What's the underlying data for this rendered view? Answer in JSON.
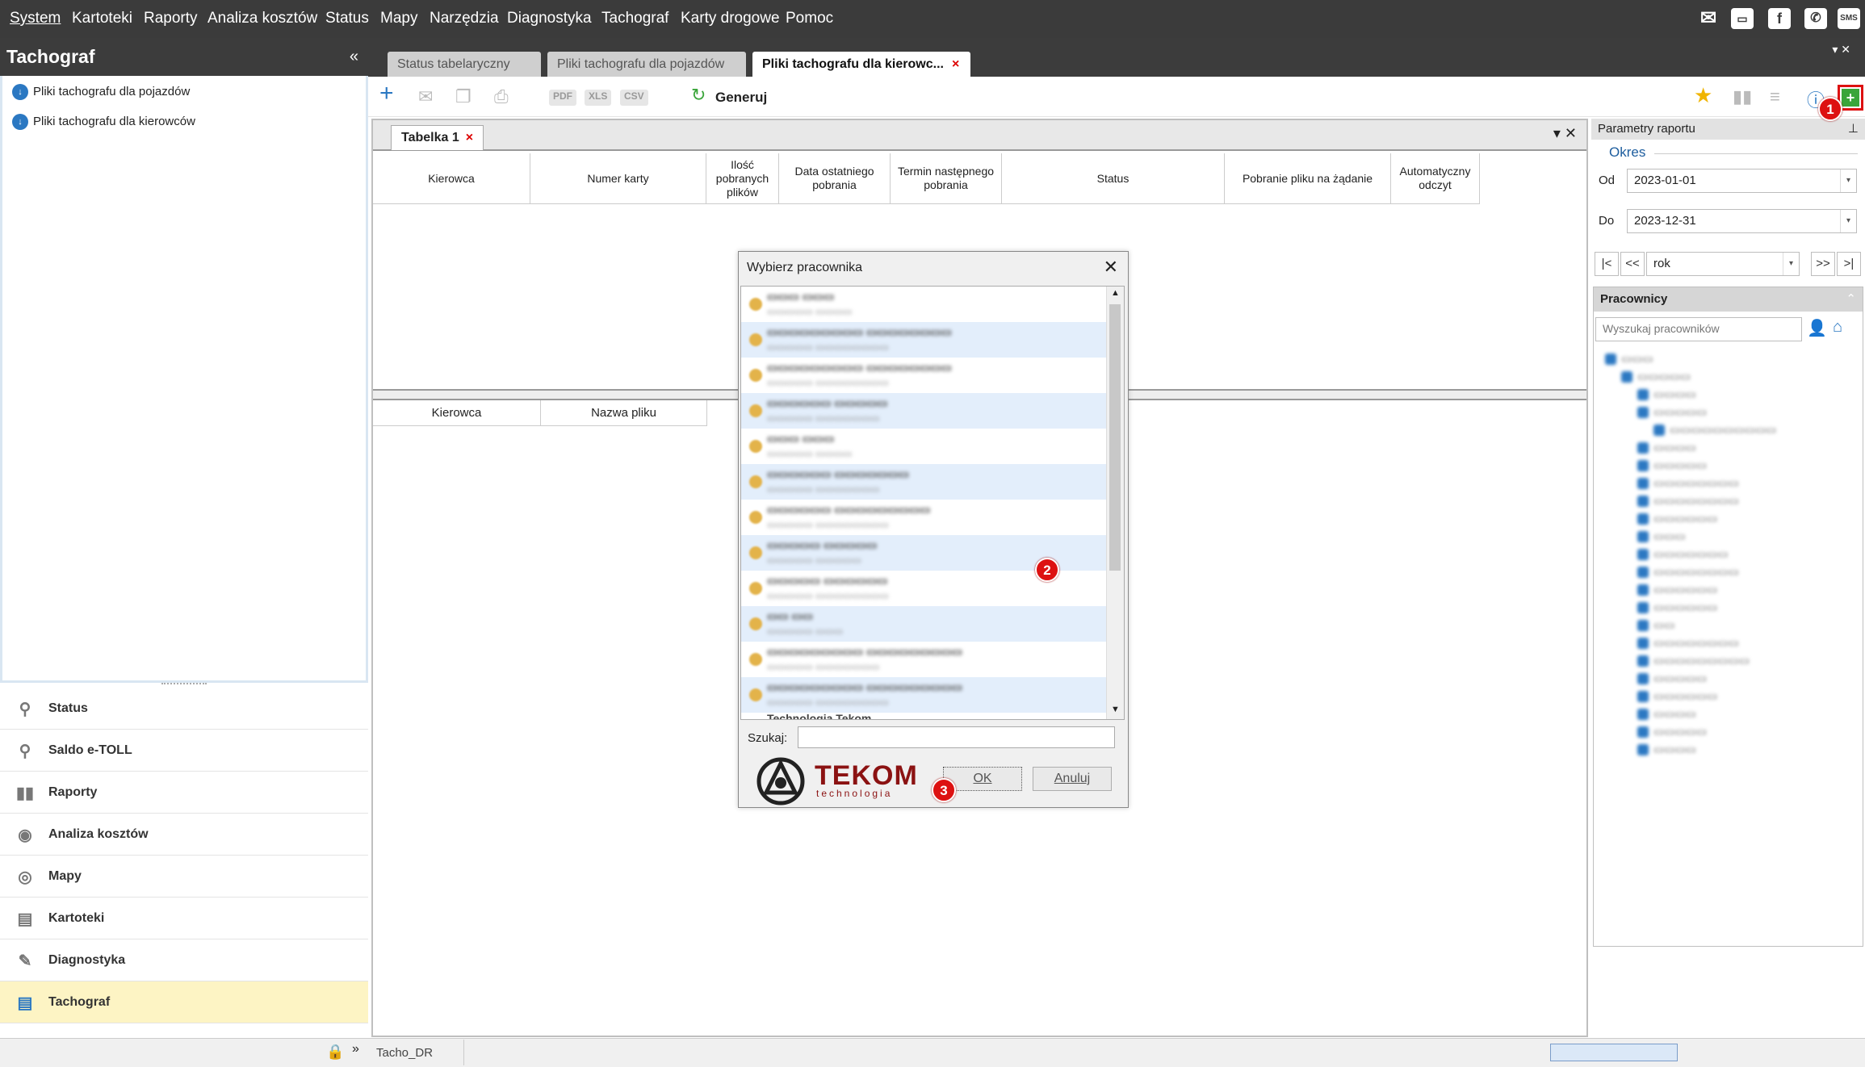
{
  "menu": [
    "System",
    "Kartoteki",
    "Raporty",
    "Analiza kosztów",
    "Status",
    "Mapy",
    "Narzędzia",
    "Diagnostyka",
    "Tachograf",
    "Karty drogowe",
    "Pomoc"
  ],
  "top_icons": {
    "sms": "SMS"
  },
  "left_panel": {
    "title": "Tachograf",
    "collapse": "«",
    "tree": [
      "Pliki tachografu dla pojazdów",
      "Pliki tachografu dla kierowców"
    ],
    "nav": [
      "Status",
      "Saldo e-TOLL",
      "Raporty",
      "Analiza kosztów",
      "Mapy",
      "Kartoteki",
      "Diagnostyka",
      "Tachograf"
    ]
  },
  "tabs": [
    {
      "label": "Status tabelaryczny"
    },
    {
      "label": "Pliki tachografu dla pojazdów"
    },
    {
      "label": "Pliki tachografu dla kierowc...",
      "close": "×"
    }
  ],
  "toolbar": {
    "pdf": "PDF",
    "xls": "XLS",
    "csv": "CSV",
    "generate": "Generuj"
  },
  "subtab": {
    "label": "Tabelka 1",
    "close": "×"
  },
  "table1_columns": [
    "Kierowca",
    "Numer karty",
    "Ilość pobranych plików",
    "Data ostatniego pobrania",
    "Termin następnego pobrania",
    "Status",
    "Pobranie pliku na żądanie",
    "Automatyczny odczyt"
  ],
  "table2_columns": [
    "Kierowca",
    "Nazwa pliku"
  ],
  "params": {
    "title": "Parametry raportu",
    "period": "Okres",
    "from_label": "Od",
    "from_value": "2023-01-01",
    "to_label": "Do",
    "to_value": "2023-12-31",
    "range_value": "rok",
    "nav": [
      "|<",
      "<<",
      ">>",
      ">|"
    ],
    "employees_title": "Pracownicy",
    "search_placeholder": "Wyszukaj pracowników"
  },
  "dialog": {
    "title": "Wybierz pracownika",
    "search_label": "Szukaj:",
    "logo_main": "TEKOM",
    "logo_sub": "technologia",
    "ok": "OK",
    "cancel": "Anuluj",
    "partial_row": "Technologia Tekom"
  },
  "markers": [
    "1",
    "2",
    "3"
  ],
  "status": {
    "left": "Tacho_DR"
  }
}
